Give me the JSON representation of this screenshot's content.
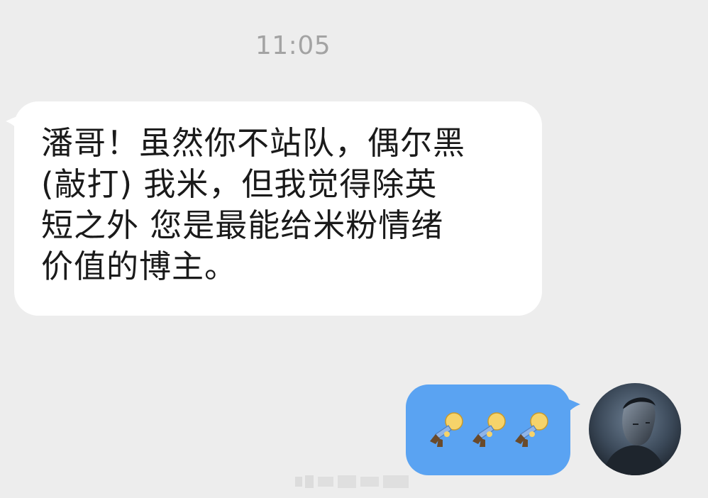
{
  "chat": {
    "timestamp": "11:05",
    "incoming_message": {
      "text": "潘哥！虽然你不站队，偶尔黑\n(敲打) 我米，但我觉得除英\n短之外 您是最能给米粉情绪\n价值的博主。"
    },
    "outgoing_message": {
      "stickers": [
        "bowing-figure-sticker",
        "bowing-figure-sticker",
        "bowing-figure-sticker"
      ]
    },
    "user_avatar": "avatar-icon"
  },
  "colors": {
    "background": "#ededed",
    "incoming_bubble": "#ffffff",
    "outgoing_bubble": "#5aa3f2",
    "text": "#1a1a1a",
    "timestamp": "#a3a3a3"
  }
}
